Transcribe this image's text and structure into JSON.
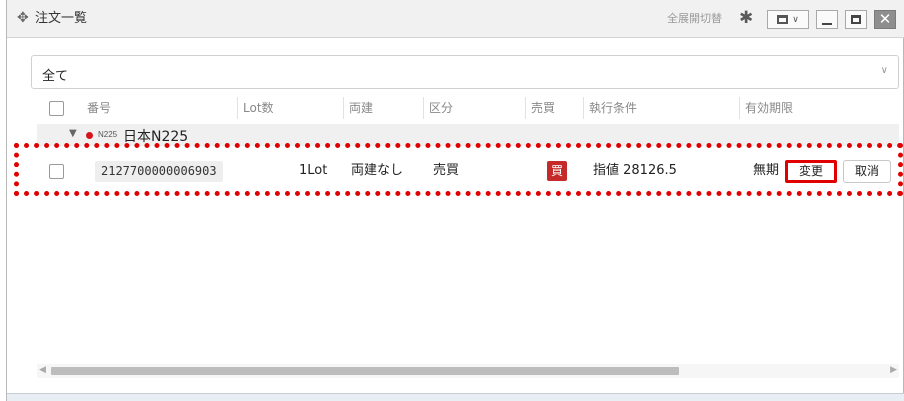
{
  "window": {
    "title": "注文一覧",
    "expand_toggle_label": "全展開切替",
    "move_icon": "move-icon",
    "settings_icon": "gear-icon",
    "layout_icon": "layout-icon",
    "close_icon": "close-icon"
  },
  "filter": {
    "selected": "全て",
    "chevron": "∨"
  },
  "table": {
    "headers": [
      "番号",
      "Lot数",
      "両建",
      "区分",
      "売買",
      "執行条件",
      "有効期限"
    ],
    "group": {
      "code": "N225",
      "name": "日本N225",
      "dot_color": "#d4141b"
    },
    "rows": [
      {
        "order_no": "2127700000006903",
        "lot": "1Lot",
        "hedge": "両建なし",
        "type": "売買",
        "side": "買",
        "condition": "指値 28126.5",
        "expiry": "無期",
        "change_label": "変更",
        "cancel_label": "取消"
      }
    ]
  },
  "scrollbar": {
    "horizontal_position": 0.0
  },
  "colors": {
    "highlight": "#e00000",
    "buy_badge": "#c42a2a"
  }
}
